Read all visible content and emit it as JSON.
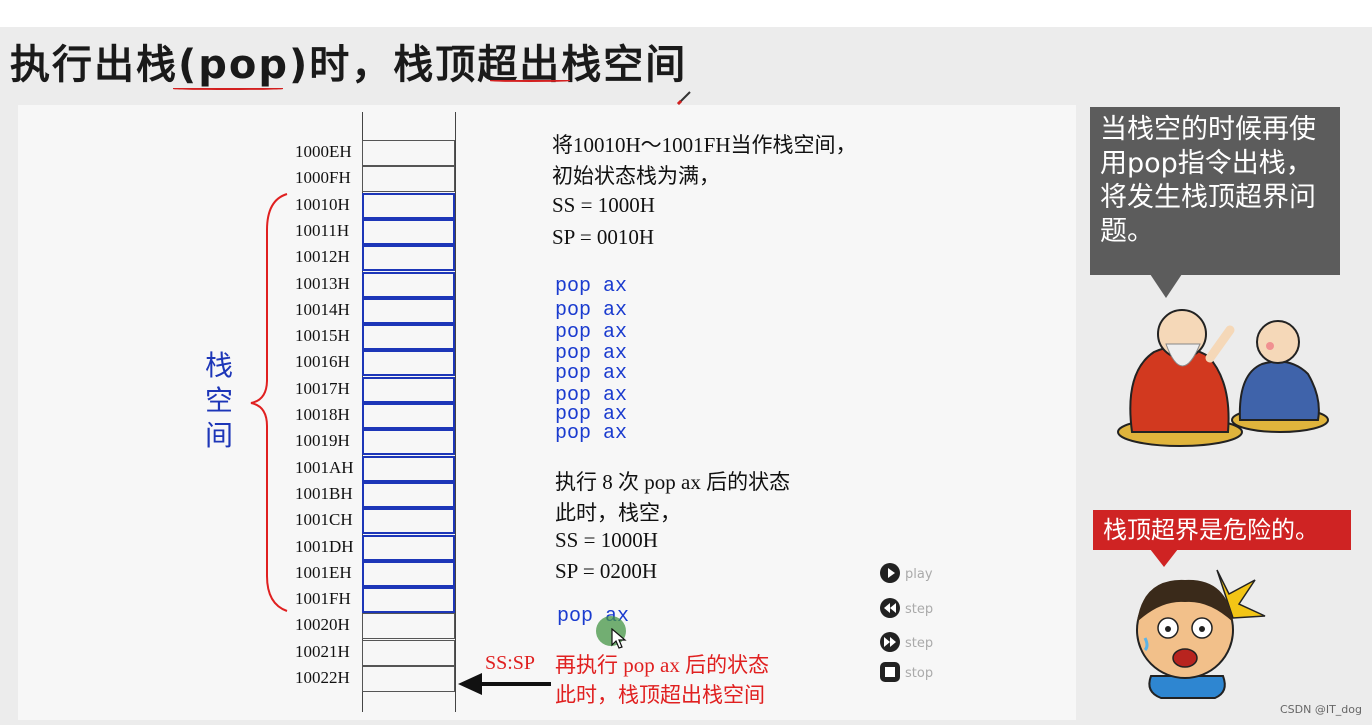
{
  "title": "执行出栈(pop)时，栈顶超出栈空间",
  "stack": {
    "addresses": [
      "1000EH",
      "1000FH",
      "10010H",
      "10011H",
      "10012H",
      "10013H",
      "10014H",
      "10015H",
      "10016H",
      "10017H",
      "10018H",
      "10019H",
      "1001AH",
      "1001BH",
      "1001CH",
      "1001DH",
      "1001EH",
      "1001FH",
      "10020H",
      "10021H",
      "10022H"
    ],
    "space_label": "栈空间",
    "pointer_label": "SS:SP"
  },
  "description": {
    "line1": "将10010H～1001FH当作栈空间，",
    "line2": "初始状态栈为满，",
    "ss": "SS = 1000H",
    "sp": "SP = 0010H"
  },
  "pops": [
    "pop ax",
    "pop ax",
    "pop ax",
    "pop ax",
    "pop ax",
    "pop ax",
    "pop ax",
    "pop ax"
  ],
  "state_after": {
    "line1": "执行 8 次 pop ax 后的状态",
    "line2": "此时，栈空，",
    "ss": "SS = 1000H",
    "sp": "SP = 0200H"
  },
  "next_pop": "pop ax",
  "overflow_note": {
    "line1": "再执行 pop ax 后的状态",
    "line2": "此时，栈顶超出栈空间"
  },
  "controls": [
    {
      "icon": "play-icon",
      "label": "play"
    },
    {
      "icon": "step-back-icon",
      "label": "step"
    },
    {
      "icon": "step-forward-icon",
      "label": "step"
    },
    {
      "icon": "stop-icon",
      "label": "stop"
    }
  ],
  "bubble_text": "当栈空的时候再使用pop指令出栈，将发生栈顶超界问题。",
  "warning_text": "栈顶超界是危险的。",
  "credit": "CSDN @IT_dog",
  "colors": {
    "stack_blue": "#1d36b8",
    "accent_red": "#d32020",
    "bubble_gray": "#5c5c5c",
    "code_blue": "#1a3bcf"
  }
}
